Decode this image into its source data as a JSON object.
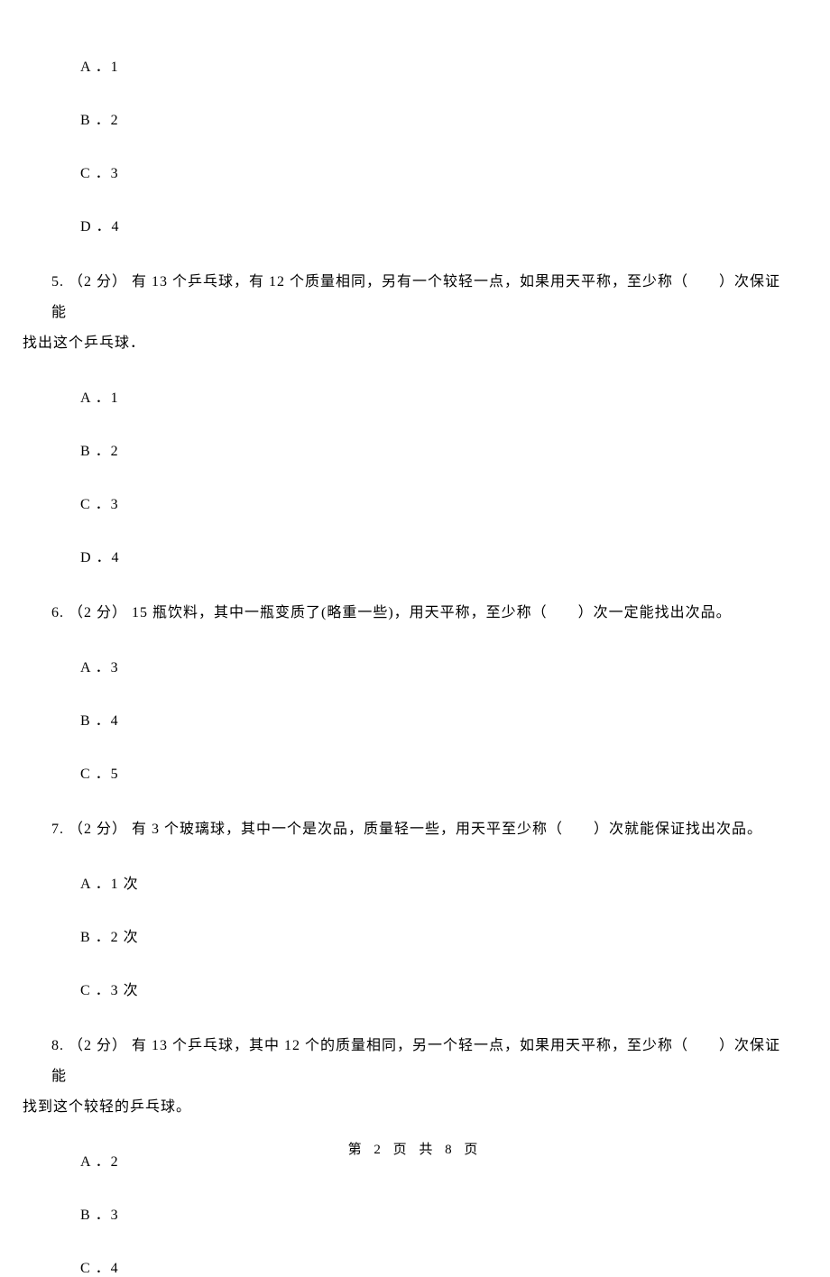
{
  "q4": {
    "optA": "A  ．1",
    "optB": "B  ．2",
    "optC": "C  ．3",
    "optD": "D  ．4"
  },
  "q5": {
    "stem_line1": "5. （2 分） 有 13 个乒乓球，有 12 个质量相同，另有一个较轻一点，如果用天平称，至少称（　　）次保证能",
    "stem_line2": "找出这个乒乓球．",
    "optA": "A  ．1",
    "optB": "B  ．2",
    "optC": "C  ．3",
    "optD": "D  ．4"
  },
  "q6": {
    "stem": "6. （2 分）  15 瓶饮料，其中一瓶变质了(略重一些)，用天平称，至少称（　　）次一定能找出次品。",
    "optA": "A  ．3",
    "optB": "B  ．4",
    "optC": "C  ．5"
  },
  "q7": {
    "stem": "7. （2 分）  有 3 个玻璃球，其中一个是次品，质量轻一些，用天平至少称（　　）次就能保证找出次品。",
    "optA": "A  ．1 次",
    "optB": "B  ．2 次",
    "optC": "C  ．3 次"
  },
  "q8": {
    "stem_line1": "8. （2 分） 有 13 个乒乓球，其中 12 个的质量相同，另一个轻一点，如果用天平称，至少称（　　）次保证能",
    "stem_line2": "找到这个较轻的乒乓球。",
    "optA": "A  ．2",
    "optB": "B  ．3",
    "optC": "C  ．4"
  },
  "footer": "第 2 页 共 8 页"
}
